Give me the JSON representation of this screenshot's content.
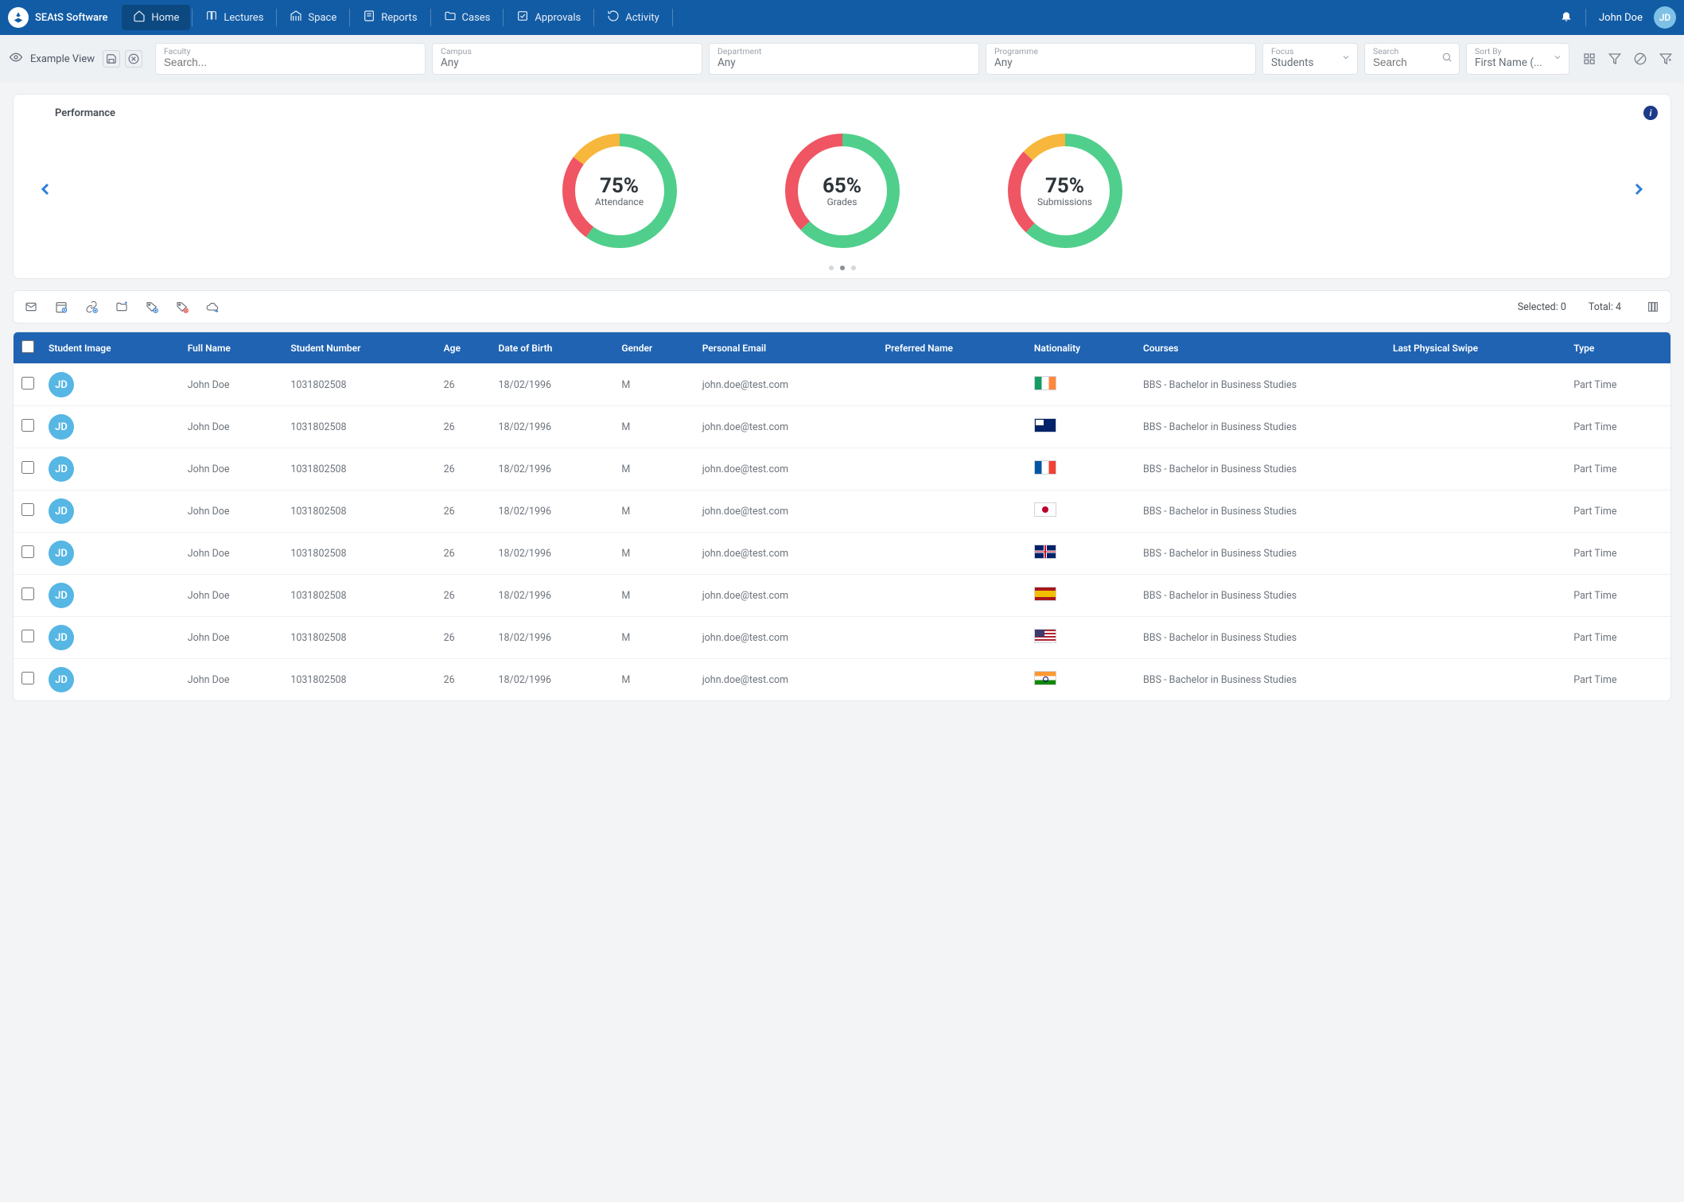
{
  "brand": {
    "name": "SEAtS Software",
    "logo_initials": ""
  },
  "nav": [
    {
      "label": "Home",
      "active": true
    },
    {
      "label": "Lectures",
      "active": false
    },
    {
      "label": "Space",
      "active": false
    },
    {
      "label": "Reports",
      "active": false
    },
    {
      "label": "Cases",
      "active": false
    },
    {
      "label": "Approvals",
      "active": false
    },
    {
      "label": "Activity",
      "active": false
    }
  ],
  "user": {
    "name": "John Doe",
    "initials": "JD"
  },
  "view": {
    "name": "Example View"
  },
  "filters": {
    "faculty": {
      "label": "Faculty",
      "placeholder": "Search...",
      "value": ""
    },
    "campus": {
      "label": "Campus",
      "value": "Any"
    },
    "department": {
      "label": "Department",
      "value": "Any"
    },
    "programme": {
      "label": "Programme",
      "value": "Any"
    },
    "focus": {
      "label": "Focus",
      "value": "Students"
    },
    "search": {
      "label": "Search",
      "placeholder": "Search",
      "value": ""
    },
    "sort": {
      "label": "Sort By",
      "value": "First Name (..."
    }
  },
  "performance": {
    "title": "Performance",
    "active_dot": 1,
    "dot_count": 3
  },
  "chart_data": [
    {
      "type": "pie",
      "title": "Attendance",
      "center_value": "75%",
      "categories": [
        "Green",
        "Red",
        "Amber"
      ],
      "values": [
        60,
        25,
        15
      ],
      "colors": [
        "#4fcf8b",
        "#ef5562",
        "#f6b73c"
      ]
    },
    {
      "type": "pie",
      "title": "Grades",
      "center_value": "65%",
      "categories": [
        "Green",
        "Red"
      ],
      "values": [
        63,
        37
      ],
      "colors": [
        "#4fcf8b",
        "#ef5562"
      ]
    },
    {
      "type": "pie",
      "title": "Submissions",
      "center_value": "75%",
      "categories": [
        "Green",
        "Red",
        "Amber"
      ],
      "values": [
        62,
        25,
        13
      ],
      "colors": [
        "#4fcf8b",
        "#ef5562",
        "#f6b73c"
      ]
    }
  ],
  "actionbar": {
    "selected_label": "Selected:",
    "selected_count": 0,
    "total_label": "Total:",
    "total_count": 4
  },
  "table": {
    "columns": [
      "Student Image",
      "Full Name",
      "Student Number",
      "Age",
      "Date of Birth",
      "Gender",
      "Personal Email",
      "Preferred Name",
      "Nationality",
      "Courses",
      "Last Physical Swipe",
      "Type"
    ],
    "rows": [
      {
        "initials": "JD",
        "full_name": "John Doe",
        "student_number": "1031802508",
        "age": "26",
        "dob": "18/02/1996",
        "gender": "M",
        "email": "john.doe@test.com",
        "preferred_name": "",
        "nationality": "ie",
        "courses": "BBS - Bachelor in Business Studies",
        "last_swipe": "",
        "type": "Part Time"
      },
      {
        "initials": "JD",
        "full_name": "John Doe",
        "student_number": "1031802508",
        "age": "26",
        "dob": "18/02/1996",
        "gender": "M",
        "email": "john.doe@test.com",
        "preferred_name": "",
        "nationality": "au",
        "courses": "BBS - Bachelor in Business Studies",
        "last_swipe": "",
        "type": "Part Time"
      },
      {
        "initials": "JD",
        "full_name": "John Doe",
        "student_number": "1031802508",
        "age": "26",
        "dob": "18/02/1996",
        "gender": "M",
        "email": "john.doe@test.com",
        "preferred_name": "",
        "nationality": "fr",
        "courses": "BBS - Bachelor in Business Studies",
        "last_swipe": "",
        "type": "Part Time"
      },
      {
        "initials": "JD",
        "full_name": "John Doe",
        "student_number": "1031802508",
        "age": "26",
        "dob": "18/02/1996",
        "gender": "M",
        "email": "john.doe@test.com",
        "preferred_name": "",
        "nationality": "jp",
        "courses": "BBS - Bachelor in Business Studies",
        "last_swipe": "",
        "type": "Part Time"
      },
      {
        "initials": "JD",
        "full_name": "John Doe",
        "student_number": "1031802508",
        "age": "26",
        "dob": "18/02/1996",
        "gender": "M",
        "email": "john.doe@test.com",
        "preferred_name": "",
        "nationality": "gb",
        "courses": "BBS - Bachelor in Business Studies",
        "last_swipe": "",
        "type": "Part Time"
      },
      {
        "initials": "JD",
        "full_name": "John Doe",
        "student_number": "1031802508",
        "age": "26",
        "dob": "18/02/1996",
        "gender": "M",
        "email": "john.doe@test.com",
        "preferred_name": "",
        "nationality": "es",
        "courses": "BBS - Bachelor in Business Studies",
        "last_swipe": "",
        "type": "Part Time"
      },
      {
        "initials": "JD",
        "full_name": "John Doe",
        "student_number": "1031802508",
        "age": "26",
        "dob": "18/02/1996",
        "gender": "M",
        "email": "john.doe@test.com",
        "preferred_name": "",
        "nationality": "us",
        "courses": "BBS - Bachelor in Business Studies",
        "last_swipe": "",
        "type": "Part Time"
      },
      {
        "initials": "JD",
        "full_name": "John Doe",
        "student_number": "1031802508",
        "age": "26",
        "dob": "18/02/1996",
        "gender": "M",
        "email": "john.doe@test.com",
        "preferred_name": "",
        "nationality": "in",
        "courses": "BBS - Bachelor in Business Studies",
        "last_swipe": "",
        "type": "Part Time"
      }
    ]
  }
}
